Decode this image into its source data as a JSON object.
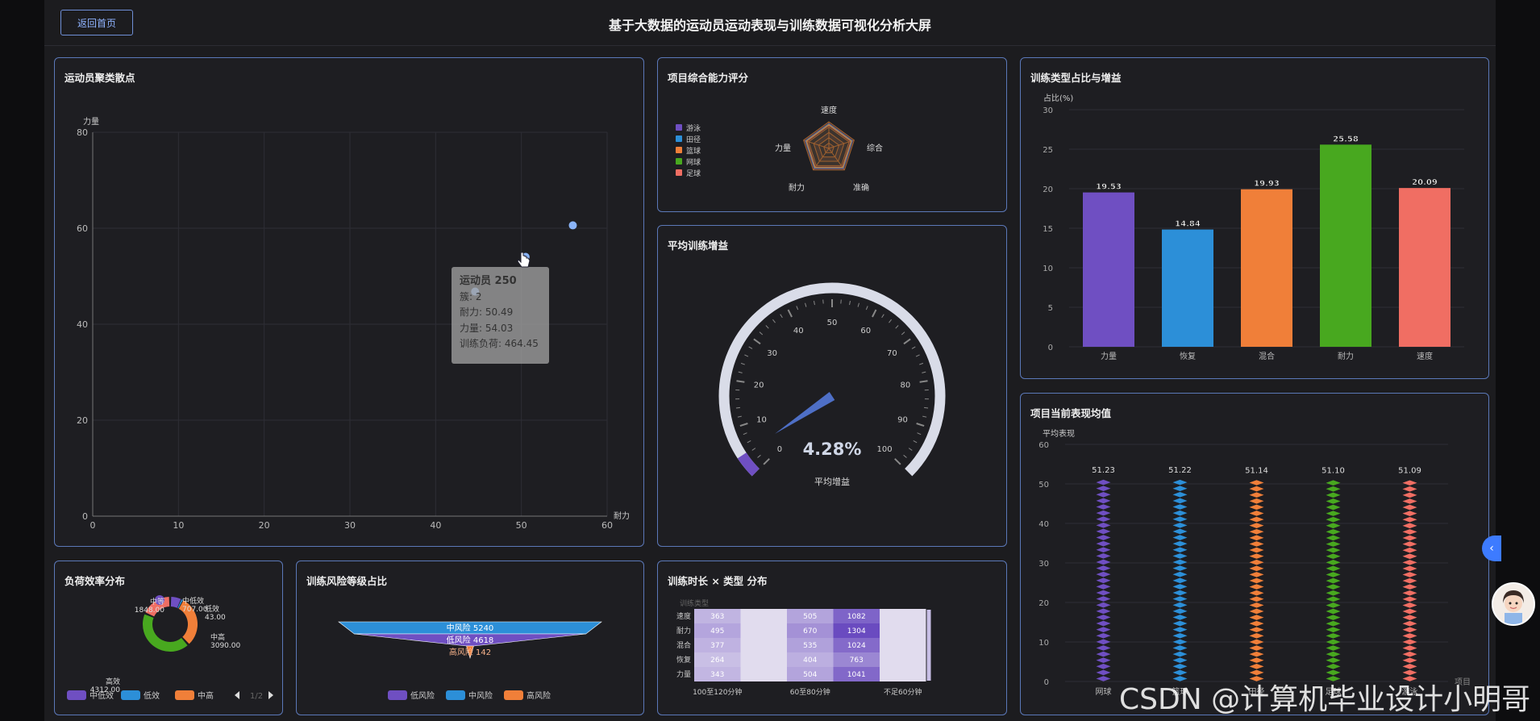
{
  "header": {
    "back_label": "返回首页",
    "title": "基于大数据的运动员运动表现与训练数据可视化分析大屏"
  },
  "panels": {
    "scatter": "运动员聚类散点",
    "radar": "项目综合能力评分",
    "bar": "训练类型占比与增益",
    "gauge": "平均训练增益",
    "pictorial": "项目当前表现均值",
    "donut": "负荷效率分布",
    "funnel": "训练风险等级占比",
    "heatmap": "训练时长 × 类型 分布"
  },
  "tooltip": {
    "title": "运动员 250",
    "cluster": "簇: 2",
    "endurance": "耐力: 50.49",
    "strength": "力量: 54.03",
    "load": "训练负荷: 464.45"
  },
  "chart_data": [
    {
      "type": "scatter",
      "title": "运动员聚类散点",
      "xlabel": "耐力",
      "ylabel": "力量",
      "xlim": [
        0,
        60
      ],
      "ylim": [
        0,
        80
      ],
      "xticks": [
        0,
        10,
        20,
        30,
        40,
        50,
        60
      ],
      "yticks": [
        0,
        20,
        40,
        60,
        80
      ],
      "grid": true,
      "points": [
        {
          "x": 56.0,
          "y": 60.6
        },
        {
          "x": 50.49,
          "y": 54.03
        },
        {
          "x": 44.6,
          "y": 46.8
        }
      ],
      "colors": {
        "point": "#8ab4f8"
      }
    },
    {
      "type": "radar",
      "title": "项目综合能力评分",
      "indicators": [
        "速度",
        "综合",
        "准确",
        "耐力",
        "力量"
      ],
      "legend": [
        "游泳",
        "田径",
        "篮球",
        "网球",
        "足球"
      ],
      "colors": [
        "#6f4fc2",
        "#2c8fd8",
        "#f07f39",
        "#48a81f",
        "#f06e63"
      ],
      "legend_position": "left"
    },
    {
      "type": "bar",
      "title": "训练类型占比与增益",
      "ylabel": "占比(%)",
      "ylim": [
        0,
        30
      ],
      "yticks": [
        0,
        5,
        10,
        15,
        20,
        25,
        30
      ],
      "categories": [
        "力量",
        "恢复",
        "混合",
        "耐力",
        "速度"
      ],
      "values": [
        19.53,
        14.84,
        19.93,
        25.58,
        20.09
      ],
      "colors": [
        "#6f4fc2",
        "#2c8fd8",
        "#f07f39",
        "#48a81f",
        "#f06e63"
      ]
    },
    {
      "type": "gauge",
      "title": "平均训练增益",
      "min": 0,
      "max": 100,
      "ticks": [
        0,
        10,
        20,
        30,
        40,
        50,
        60,
        70,
        80,
        90,
        100
      ],
      "value": 4.28,
      "value_text": "4.28%",
      "label": "平均增益"
    },
    {
      "type": "bar",
      "subtype": "pictorial",
      "title": "项目当前表现均值",
      "ylabel": "平均表现",
      "xlabel": "项目",
      "ylim": [
        0,
        60
      ],
      "yticks": [
        0,
        10,
        20,
        30,
        40,
        50,
        60
      ],
      "categories": [
        "网球",
        "篮球",
        "田径",
        "足球",
        "游泳"
      ],
      "values": [
        51.23,
        51.22,
        51.14,
        51.1,
        51.09
      ],
      "value_labels": [
        "51.23",
        "51.22",
        "51.14",
        "51.10",
        "51.09"
      ],
      "colors": [
        "#6f4fc2",
        "#2c8fd8",
        "#f07f39",
        "#48a81f",
        "#f06e63"
      ]
    },
    {
      "type": "pie",
      "subtype": "donut",
      "title": "负荷效率分布",
      "slices": [
        {
          "name": "中低效",
          "value": 707.0
        },
        {
          "name": "低效",
          "value": 43.0
        },
        {
          "name": "中高",
          "value": 3090.0
        },
        {
          "name": "高效",
          "value": 4312.0
        },
        {
          "name": "中等",
          "value": 1848.0
        }
      ],
      "value_labels": [
        "707.00",
        "43.00",
        "3090.00",
        "4312.00",
        "1848.00"
      ],
      "legend": [
        "中低效",
        "低效",
        "中高"
      ],
      "legend_page": "1/2",
      "colors": [
        "#6f4fc2",
        "#2c8fd8",
        "#f07f39",
        "#48a81f",
        "#f06e63"
      ]
    },
    {
      "type": "funnel",
      "title": "训练风险等级占比",
      "stages": [
        {
          "name": "中风险",
          "value": 5240
        },
        {
          "name": "低风险",
          "value": 4618
        },
        {
          "name": "高风险",
          "value": 142
        }
      ],
      "stage_labels": [
        "中风险 5240",
        "低风险 4618",
        "高风险 142"
      ],
      "legend": [
        "低风险",
        "中风险",
        "高风险"
      ],
      "colors": {
        "低风险": "#6f4fc2",
        "中风险": "#2c8fd8",
        "高风险": "#f07f39"
      }
    },
    {
      "type": "heatmap",
      "title": "训练时长 × 类型 分布",
      "ylabel": "训练类型",
      "y_categories": [
        "速度",
        "耐力",
        "混合",
        "恢复",
        "力量"
      ],
      "x_categories": [
        "100至120分钟",
        "",
        "60至80分钟",
        "",
        "不足60分钟"
      ],
      "values": [
        [
          363,
          0,
          505,
          1082,
          0
        ],
        [
          495,
          0,
          670,
          1304,
          0
        ],
        [
          377,
          0,
          535,
          1024,
          0
        ],
        [
          264,
          0,
          404,
          763,
          0
        ],
        [
          343,
          0,
          504,
          1041,
          0
        ]
      ],
      "value_labels": [
        [
          "363",
          "",
          "505",
          "1082",
          ""
        ],
        [
          "495",
          "",
          "670",
          "1304",
          ""
        ],
        [
          "377",
          "",
          "535",
          "1024",
          ""
        ],
        [
          "264",
          "",
          "404",
          "763",
          ""
        ],
        [
          "343",
          "",
          "504",
          "1041",
          ""
        ]
      ],
      "max": 1304,
      "colors": {
        "low": "#e1dcee",
        "high": "#6a4bc0"
      }
    }
  ],
  "watermark": "CSDN @计算机毕业设计小明哥"
}
